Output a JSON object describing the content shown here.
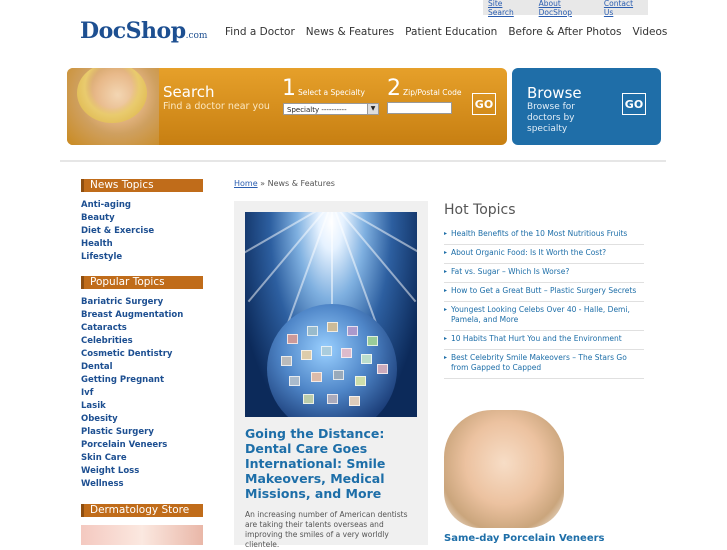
{
  "util_links": [
    "Site Search",
    "About DocShop",
    "Contact Us"
  ],
  "logo": {
    "main": "DocShop",
    "suffix": ".com"
  },
  "nav": [
    "Find a Doctor",
    "News & Features",
    "Patient Education",
    "Before & After Photos",
    "Videos"
  ],
  "search": {
    "title": "Search",
    "subtitle": "Find a doctor near you",
    "step1_num": "1",
    "step1_label": "Select a Specialty",
    "step2_num": "2",
    "step2_label": "Zip/Postal Code",
    "specialty_value": "Specialty ----------",
    "zip_value": "",
    "go": "GO"
  },
  "browse": {
    "title": "Browse",
    "subtitle": "Browse for doctors by specialty",
    "go": "GO"
  },
  "news_topics": {
    "heading": "News Topics",
    "items": [
      "Anti-aging",
      "Beauty",
      "Diet & Exercise",
      "Health",
      "Lifestyle"
    ]
  },
  "popular_topics": {
    "heading": "Popular Topics",
    "items": [
      "Bariatric Surgery",
      "Breast Augmentation",
      "Cataracts",
      "Celebrities",
      "Cosmetic Dentistry",
      "Dental",
      "Getting Pregnant",
      "Ivf",
      "Lasik",
      "Obesity",
      "Plastic Surgery",
      "Porcelain Veneers",
      "Skin Care",
      "Weight Loss",
      "Wellness"
    ]
  },
  "dermatology_store": {
    "heading": "Dermatology Store"
  },
  "breadcrumb": {
    "home": "Home",
    "separator": " » ",
    "current": "News & Features"
  },
  "feature": {
    "title": "Going the Distance: Dental Care Goes International: Smile Makeovers, Medical Missions, and More",
    "description": "An increasing number of American dentists are taking their talents overseas and improving the smiles of a very worldly clientele."
  },
  "hot_topics": {
    "heading": "Hot Topics",
    "items": [
      "Health Benefits of the 10 Most Nutritious Fruits",
      "About Organic Food: Is It Worth the Cost?",
      "Fat vs. Sugar – Which Is Worse?",
      "How to Get a Great Butt – Plastic Surgery Secrets",
      "Youngest Looking Celebs Over 40 - Halle, Demi, Pamela, and More",
      "10 Habits That Hurt You and the Environment",
      "Best Celebrity Smile Makeovers – The Stars Go from Gapped to Capped"
    ]
  },
  "promo": {
    "caption": "Same-day Porcelain Veneers"
  },
  "colors": {
    "brand_blue": "#1d4f91",
    "accent_orange": "#c06c1a",
    "browse_blue": "#1f6ea8",
    "link_blue": "#1d6ea8"
  }
}
